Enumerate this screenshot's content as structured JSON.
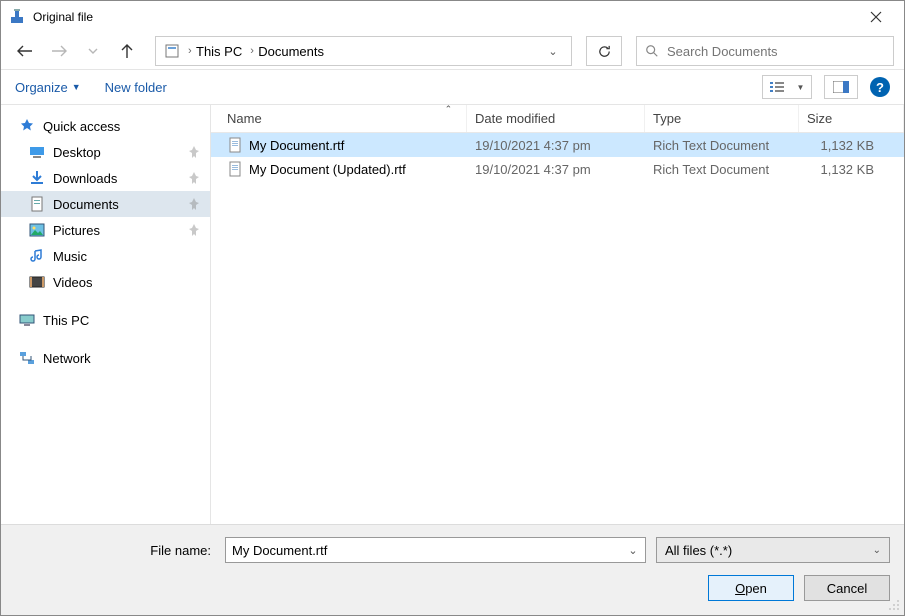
{
  "window": {
    "title": "Original file"
  },
  "nav": {
    "breadcrumb": [
      "This PC",
      "Documents"
    ],
    "search_placeholder": "Search Documents"
  },
  "commands": {
    "organize": "Organize",
    "new_folder": "New folder"
  },
  "sidebar": {
    "quick_access": "Quick access",
    "items": [
      {
        "label": "Desktop",
        "pinned": true,
        "icon": "desktop"
      },
      {
        "label": "Downloads",
        "pinned": true,
        "icon": "downloads"
      },
      {
        "label": "Documents",
        "pinned": true,
        "icon": "documents",
        "selected": true
      },
      {
        "label": "Pictures",
        "pinned": true,
        "icon": "pictures"
      },
      {
        "label": "Music",
        "pinned": false,
        "icon": "music"
      },
      {
        "label": "Videos",
        "pinned": false,
        "icon": "videos"
      }
    ],
    "this_pc": "This PC",
    "network": "Network"
  },
  "columns": {
    "name": "Name",
    "modified": "Date modified",
    "type": "Type",
    "size": "Size"
  },
  "files": [
    {
      "name": "My Document.rtf",
      "modified": "19/10/2021 4:37 pm",
      "type": "Rich Text Document",
      "size": "1,132 KB",
      "selected": true
    },
    {
      "name": "My Document (Updated).rtf",
      "modified": "19/10/2021 4:37 pm",
      "type": "Rich Text Document",
      "size": "1,132 KB",
      "selected": false
    }
  ],
  "footer": {
    "filename_label": "File name:",
    "filename_value": "My Document.rtf",
    "filter": "All files (*.*)",
    "open": "Open",
    "cancel": "Cancel"
  }
}
